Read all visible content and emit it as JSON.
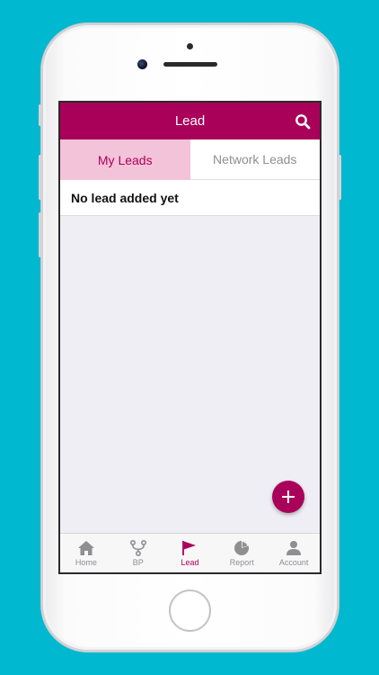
{
  "header": {
    "title": "Lead"
  },
  "tabs": [
    {
      "label": "My Leads",
      "active": true
    },
    {
      "label": "Network Leads",
      "active": false
    }
  ],
  "leads": {
    "empty_message": "No lead added yet"
  },
  "tabbar": {
    "items": [
      {
        "label": "Home",
        "icon": "home-icon",
        "active": false
      },
      {
        "label": "BP",
        "icon": "branch-icon",
        "active": false
      },
      {
        "label": "Lead",
        "icon": "flag-icon",
        "active": true
      },
      {
        "label": "Report",
        "icon": "pie-chart-icon",
        "active": false
      },
      {
        "label": "Account",
        "icon": "user-icon",
        "active": false
      }
    ]
  },
  "colors": {
    "brand": "#a90059",
    "active_tab_bg": "#f3c3d9",
    "background": "#00b8cf",
    "inactive": "#8e8e93"
  }
}
